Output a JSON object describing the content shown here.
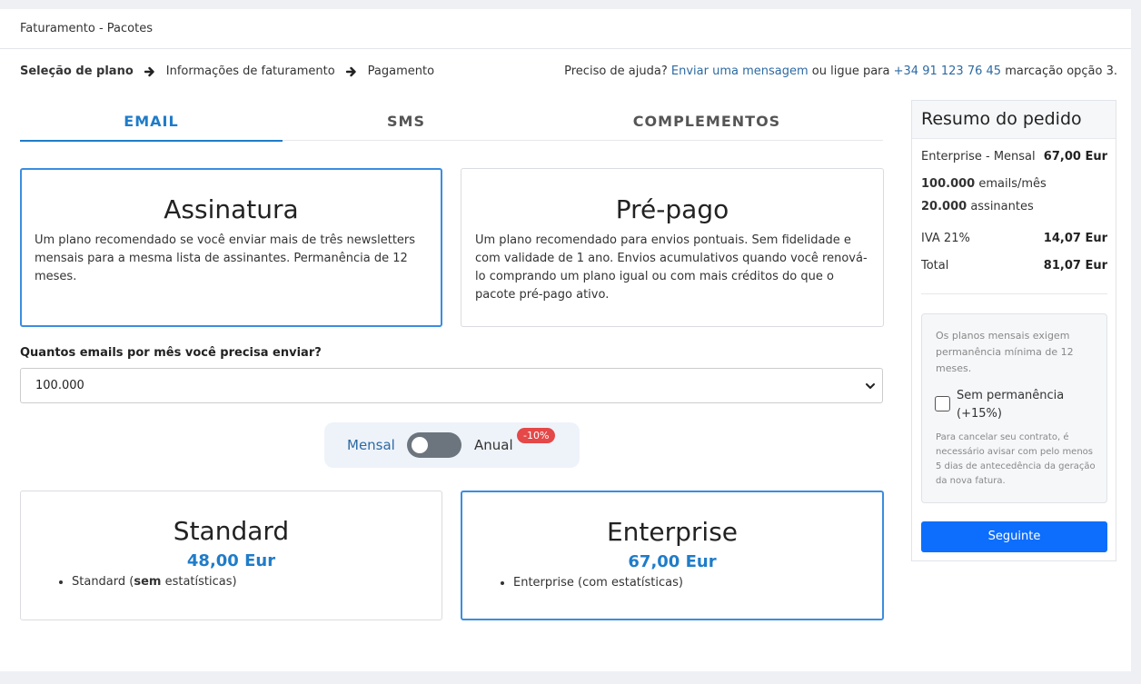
{
  "header": {
    "title": "Faturamento - Pacotes"
  },
  "breadcrumb": {
    "steps": [
      "Seleção de plano",
      "Informações de faturamento",
      "Pagamento"
    ]
  },
  "help": {
    "prefix": "Preciso de ajuda?",
    "link": "Enviar uma mensagem",
    "middle": "ou ligue para",
    "phone": "+34 91 123 76 45",
    "suffix": "marcação opção 3."
  },
  "tabs": [
    {
      "label": "EMAIL",
      "active": true
    },
    {
      "label": "SMS",
      "active": false
    },
    {
      "label": "COMPLEMENTOS",
      "active": false
    }
  ],
  "plan_types": [
    {
      "title": "Assinatura",
      "description": "Um plano recomendado se você enviar mais de três newsletters mensais para a mesma lista de assinantes. Permanência de 12 meses.",
      "selected": true
    },
    {
      "title": "Pré-pago",
      "description": "Um plano recomendado para envios pontuais. Sem fidelidade e com validade de 1 ano. Envios acumulativos quando você renová-lo comprando um plano igual ou com mais créditos do que o pacote pré-pago ativo.",
      "selected": false
    }
  ],
  "volume": {
    "label": "Quantos emails por mês você precisa enviar?",
    "value": "100.000"
  },
  "billing": {
    "monthly": "Mensal",
    "annual": "Anual",
    "discount": "-10%",
    "annual_on": false
  },
  "plans": [
    {
      "name": "Standard",
      "price": "48,00 Eur",
      "feature_name": "Standard (",
      "feature_bold": "sem",
      "feature_rest": " estatísticas)",
      "selected": false
    },
    {
      "name": "Enterprise",
      "price": "67,00 Eur",
      "feature": "Enterprise (com estatísticas)",
      "selected": true
    }
  ],
  "summary": {
    "title": "Resumo do pedido",
    "plan_label": "Enterprise - Mensal",
    "plan_value": "67,00 Eur",
    "emails_count": "100.000",
    "emails_unit": "emails/mês",
    "subs_count": "20.000",
    "subs_unit": "assinantes",
    "iva_label": "IVA 21%",
    "iva_value": "14,07 Eur",
    "total_label": "Total",
    "total_value": "81,07 Eur",
    "notice": "Os planos mensais exigem permanência mínima de 12 meses.",
    "checkbox_label": "Sem permanência (+15%)",
    "cancel_note": "Para cancelar seu contrato, é necessário avisar com pelo menos 5 dias de antecedência da geração da nova fatura.",
    "next_button": "Seguinte"
  }
}
